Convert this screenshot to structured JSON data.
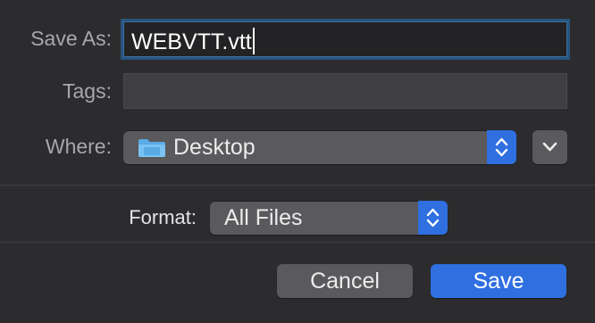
{
  "save_as": {
    "label": "Save As:",
    "value": "WEBVTT.vtt"
  },
  "tags": {
    "label": "Tags:",
    "value": ""
  },
  "where": {
    "label": "Where:",
    "value": "Desktop",
    "icon": "folder-icon"
  },
  "format": {
    "label": "Format:",
    "value": "All Files"
  },
  "buttons": {
    "cancel": "Cancel",
    "save": "Save"
  },
  "colors": {
    "accent": "#2f6fe0",
    "focus_ring": "#27557f",
    "background": "#2c2b2d",
    "label_text": "#a8a7aa"
  }
}
